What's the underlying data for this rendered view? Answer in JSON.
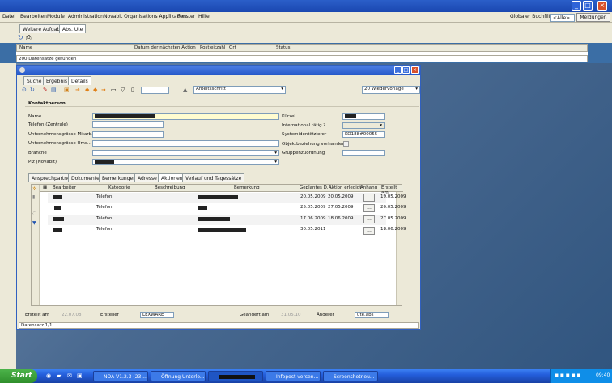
{
  "colors": {
    "taskbar": "#245edb",
    "title": "#2457c9",
    "desktop": "#4a6a91",
    "highlight": "#fffcd0"
  },
  "menubar": {
    "items": [
      "Datei",
      "Bearbeiten",
      "Module",
      "Administration",
      "Novabit Organisations Applikation",
      "Fenster",
      "Hilfe"
    ],
    "filter_label": "Globaler Buchfilter:",
    "filter_value": "<Alle>",
    "messages_button": "Meldungen"
  },
  "top_tabs": [
    "Weitere Aufgaben",
    "Abs. Ute"
  ],
  "grid": {
    "columns": [
      "Name",
      "Datum der nächsten Aktion",
      "Postleitzahl",
      "Ort",
      "Status"
    ],
    "found": "200 Datensätze gefunden"
  },
  "dialog": {
    "tabs": [
      "Suche",
      "Ergebnis",
      "Details"
    ],
    "combo_left": "Arbeitsschritt",
    "combo_right": "20 Wiedervorlage",
    "section": "Kontaktperson",
    "labels": {
      "name": "Name",
      "phone": "Telefon (Zentrale)",
      "staff": "Unternehmensgrösse Mitarb...",
      "revenue": "Unternehmensgrösse Ums...",
      "branch": "Branche",
      "plz": "Plz (Novabit)",
      "short": "Kürzel",
      "intl": "International tätig ?",
      "sysid": "Systemidentifizierer",
      "objrel": "Objektbeziehung vorhanden",
      "group": "Gruppenzuordnung"
    },
    "sysid_value": "KO188#00055",
    "sub_tabs": [
      "Ansprechpartner",
      "Dokumente",
      "Bemerkungen",
      "Adresse",
      "Aktionen",
      "Verlauf und Tagessätze"
    ],
    "table": {
      "headers": [
        "Bearbeiter",
        "Kategorie",
        "Beschreibung",
        "Bemerkung",
        "Geplantes D...",
        "Aktion erledigt",
        "Anhang",
        "Erstellt am"
      ],
      "rows": [
        {
          "category": "Telefon",
          "planned": "20.05.2009",
          "done": "20.05.2009",
          "created": "19.05.2009"
        },
        {
          "category": "Telefon",
          "planned": "25.05.2009",
          "done": "27.05.2009",
          "created": "20.05.2009"
        },
        {
          "category": "Telefon",
          "planned": "17.06.2009",
          "done": "18.06.2009",
          "created": "27.05.2009"
        },
        {
          "category": "Telefon",
          "planned": "30.05.2011",
          "done": "",
          "created": "18.06.2009"
        }
      ],
      "attach_btn": "..."
    },
    "footer": {
      "created_label": "Erstellt am",
      "created_value": "22.07.08",
      "creator_label": "Ersteller",
      "creator_value": "LEXWARE",
      "changed_label": "Geändert am",
      "changed_value": "31.05.10",
      "changer_label": "Änderer",
      "changer_value": "ute.abs",
      "status": "Datensatz 1/1"
    }
  },
  "taskbar": {
    "start": "Start",
    "tasks": [
      "NOA V1.2.3 (23....",
      "Öffnung Unterlo...",
      "",
      "Infopost versen...",
      "Screenshotneu..."
    ],
    "clock": "09:40"
  }
}
